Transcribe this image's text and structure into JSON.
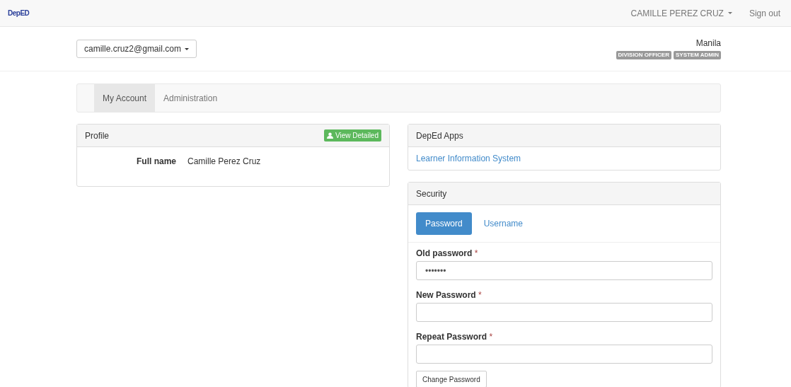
{
  "navbar": {
    "logo": "DepED",
    "user_menu": "CAMILLE PEREZ CRUZ",
    "sign_out": "Sign out"
  },
  "header": {
    "account_dropdown": "camille.cruz2@gmail.com",
    "location": "Manila",
    "roles": [
      "DIVISION OFFICER",
      "SYSTEM ADMIN"
    ]
  },
  "tabs": [
    {
      "label": "My Account",
      "selected": true
    },
    {
      "label": "Administration",
      "selected": false
    }
  ],
  "profile": {
    "title": "Profile",
    "action": "View Detailed",
    "fields": [
      {
        "label": "Full name",
        "value": "Camille Perez Cruz"
      }
    ]
  },
  "apps": {
    "title": "DepEd Apps",
    "links": [
      "Learner Information System"
    ]
  },
  "security": {
    "title": "Security",
    "tabs": [
      {
        "label": "Password",
        "selected": true
      },
      {
        "label": "Username",
        "selected": false
      }
    ],
    "fields": [
      {
        "label": "Old password",
        "marker": "*",
        "value": "•••••••"
      },
      {
        "label": "New Password",
        "marker": "*"
      },
      {
        "label": "Repeat Password",
        "marker": "*"
      }
    ],
    "submit": "Change Password"
  }
}
